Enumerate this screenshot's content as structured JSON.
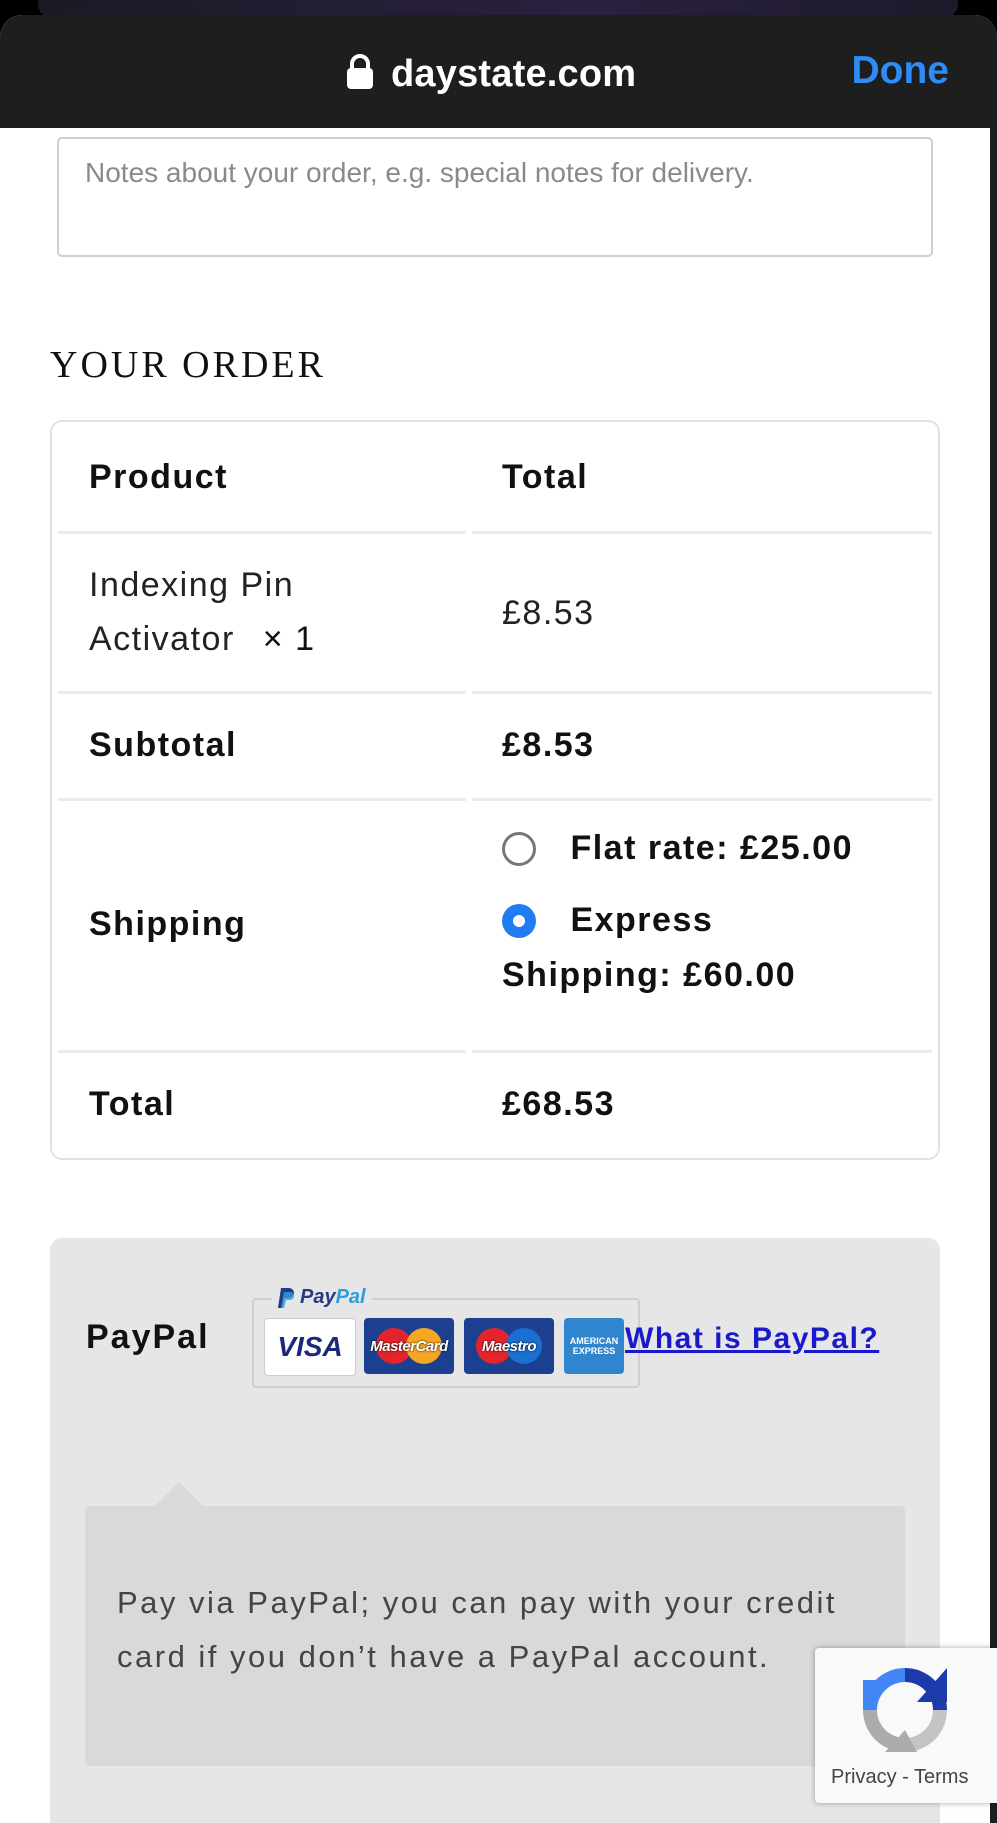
{
  "browser": {
    "url": "daystate.com",
    "done_label": "Done"
  },
  "notes": {
    "placeholder": "Notes about your order, e.g. special notes for delivery."
  },
  "order": {
    "heading": "YOUR ORDER",
    "col_product": "Product",
    "col_total": "Total",
    "item_name_line1": "Indexing Pin",
    "item_name_line2": "Activator",
    "item_qty": "× 1",
    "item_price": "£8.53",
    "subtotal_label": "Subtotal",
    "subtotal_value": "£8.53",
    "shipping_label": "Shipping",
    "shipping_options": [
      {
        "label": "Flat rate: £25.00",
        "selected": false
      },
      {
        "label_line1": "Express",
        "label_line2": "Shipping: £60.00",
        "selected": true
      }
    ],
    "total_label": "Total",
    "total_value": "£68.53"
  },
  "payment": {
    "method_label": "PayPal",
    "logo_text_1": "Pay",
    "logo_text_2": "Pal",
    "cards": {
      "visa": "VISA",
      "mastercard": "MasterCard",
      "maestro": "Maestro",
      "amex": "AMERICAN EXPRESS"
    },
    "what_is_link": "What is PayPal?",
    "description": "Pay via PayPal; you can pay with your credit card if you don’t have a PayPal account."
  },
  "recaptcha": {
    "privacy": "Privacy",
    "separator": " - ",
    "terms": "Terms"
  },
  "colors": {
    "accent_blue": "#2f8cf5",
    "radio_selected": "#1f7cf2",
    "link": "#1a1acc",
    "browser_bar": "#1e1e1e"
  }
}
